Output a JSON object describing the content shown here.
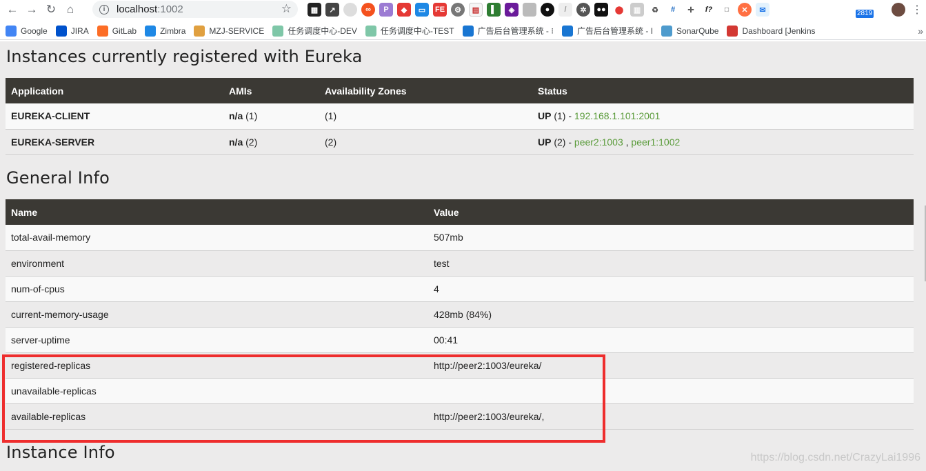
{
  "browser": {
    "url_host": "localhost",
    "url_port": ":1002",
    "badge_count": "2819",
    "bookmarks": [
      {
        "label": "Google",
        "icon": "google-icon",
        "color": "#4285f4"
      },
      {
        "label": "JIRA",
        "icon": "jira-icon",
        "color": "#0052cc"
      },
      {
        "label": "GitLab",
        "icon": "gitlab-icon",
        "color": "#fc6d26"
      },
      {
        "label": "Zimbra",
        "icon": "zimbra-icon",
        "color": "#1e88e5"
      },
      {
        "label": "MZJ-SERVICE",
        "icon": "mzj-icon",
        "color": "#e0a040"
      },
      {
        "label": "任务调度中心-DEV",
        "icon": "xxl-icon",
        "color": "#7fc7a8"
      },
      {
        "label": "任务调度中心-TEST",
        "icon": "xxl-icon",
        "color": "#7fc7a8"
      },
      {
        "label": "广告后台管理系统 - ⁝",
        "icon": "ad-admin-icon",
        "color": "#1976d2"
      },
      {
        "label": "广告后台管理系统 - I",
        "icon": "ad-admin-icon",
        "color": "#1976d2"
      },
      {
        "label": "SonarQube",
        "icon": "sonarqube-icon",
        "color": "#4e9bcd"
      },
      {
        "label": "Dashboard [Jenkins",
        "icon": "jenkins-icon",
        "color": "#d33833"
      }
    ]
  },
  "page": {
    "instances_title": "Instances currently registered with Eureka",
    "instances_headers": [
      "Application",
      "AMIs",
      "Availability Zones",
      "Status"
    ],
    "instances": [
      {
        "application": "EUREKA-CLIENT",
        "ami_label": "n/a",
        "ami_count": "(1)",
        "zones": "(1)",
        "status_label": "UP",
        "status_count": "(1) -",
        "links": [
          "192.168.1.101:2001"
        ]
      },
      {
        "application": "EUREKA-SERVER",
        "ami_label": "n/a",
        "ami_count": "(2)",
        "zones": "(2)",
        "status_label": "UP",
        "status_count": "(2) -",
        "links": [
          "peer2:1003",
          "peer1:1002"
        ]
      }
    ],
    "general_title": "General Info",
    "general_headers": [
      "Name",
      "Value"
    ],
    "general": [
      {
        "name": "total-avail-memory",
        "value": "507mb"
      },
      {
        "name": "environment",
        "value": "test"
      },
      {
        "name": "num-of-cpus",
        "value": "4"
      },
      {
        "name": "current-memory-usage",
        "value": "428mb (84%)"
      },
      {
        "name": "server-uptime",
        "value": "00:41"
      },
      {
        "name": "registered-replicas",
        "value": "http://peer2:1003/eureka/"
      },
      {
        "name": "unavailable-replicas",
        "value": ""
      },
      {
        "name": "available-replicas",
        "value": "http://peer2:1003/eureka/,"
      }
    ],
    "instance_info_title": "Instance Info",
    "watermark": "https://blog.csdn.net/CrazyLai1996"
  },
  "colors": {
    "header_bg": "#3b3934",
    "link_green": "#5a9b3a",
    "highlight_red": "#ee2d2d",
    "page_bg": "#ecebeb"
  }
}
